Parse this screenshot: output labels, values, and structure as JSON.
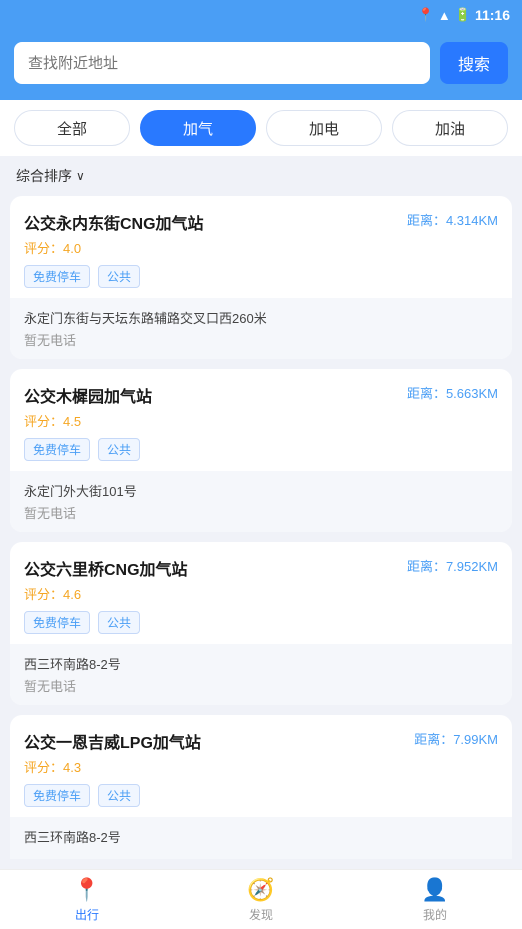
{
  "statusBar": {
    "time": "11:16"
  },
  "search": {
    "placeholder": "查找附近地址",
    "buttonLabel": "搜索"
  },
  "tabs": [
    {
      "id": "all",
      "label": "全部",
      "active": false
    },
    {
      "id": "gas",
      "label": "加气",
      "active": true
    },
    {
      "id": "electric",
      "label": "加电",
      "active": false
    },
    {
      "id": "fuel",
      "label": "加油",
      "active": false
    }
  ],
  "sort": {
    "label": "综合排序",
    "arrow": "∨"
  },
  "stations": [
    {
      "name": "公交永内东街CNG加气站",
      "distance": "距离：4.314KM",
      "rating": "评分：4.0",
      "tags": [
        "免费停车",
        "公共"
      ],
      "address": "永定门东街与天坛东路辅路交叉口西260米",
      "phone": "暂无电话"
    },
    {
      "name": "公交木樨园加气站",
      "distance": "距离：5.663KM",
      "rating": "评分：4.5",
      "tags": [
        "免费停车",
        "公共"
      ],
      "address": "永定门外大街101号",
      "phone": "暂无电话"
    },
    {
      "name": "公交六里桥CNG加气站",
      "distance": "距离：7.952KM",
      "rating": "评分：4.6",
      "tags": [
        "免费停车",
        "公共"
      ],
      "address": "西三环南路8-2号",
      "phone": "暂无电话"
    },
    {
      "name": "公交一恩吉威LPG加气站",
      "distance": "距离：7.99KM",
      "rating": "评分：4.3",
      "tags": [
        "免费停车",
        "公共"
      ],
      "address": "西三环南路8-2号",
      "phone": null
    }
  ],
  "bottomNav": [
    {
      "id": "travel",
      "label": "出行",
      "icon": "📍",
      "active": true
    },
    {
      "id": "discover",
      "label": "发现",
      "icon": "🧭",
      "active": false
    },
    {
      "id": "profile",
      "label": "我的",
      "icon": "👤",
      "active": false
    }
  ]
}
